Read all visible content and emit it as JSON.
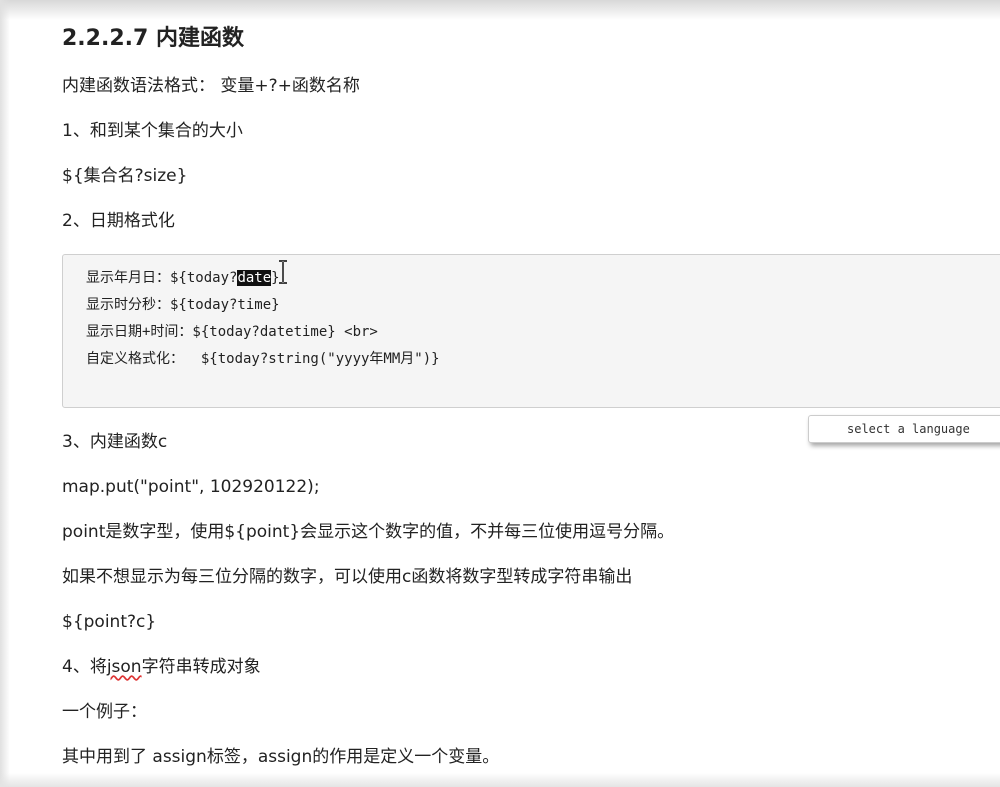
{
  "heading": "2.2.2.7 内建函数",
  "intro": "内建函数语法格式：  变量+?+函数名称",
  "items": [
    "1、和到某个集合的大小",
    "${集合名?size}",
    "2、日期格式化"
  ],
  "code_lines": {
    "line1_prefix": "显示年月日：${today?",
    "line1_highlight": "date",
    "line1_suffix": "}",
    "line2": "显示时分秒：${today?time}",
    "line3": "显示日期+时间：${today?datetime} <br>",
    "line4": "自定义格式化：  ${today?string(\"yyyy年MM月\")}"
  },
  "language_select": "select a language",
  "section3": {
    "title": "3、内建函数c",
    "example": "map.put(\"point\", 102920122);",
    "desc1": "point是数字型，使用${point}会显示这个数字的值，不并每三位使用逗号分隔。",
    "desc2": "如果不想显示为每三位分隔的数字，可以使用c函数将数字型转成字符串输出",
    "usage": "${point?c}"
  },
  "section4": {
    "title_prefix": "4、将",
    "title_word": "json",
    "title_suffix": "字符串转成对象",
    "example_label": "一个例子：",
    "note": "其中用到了 assign标签，assign的作用是定义一个变量。"
  }
}
